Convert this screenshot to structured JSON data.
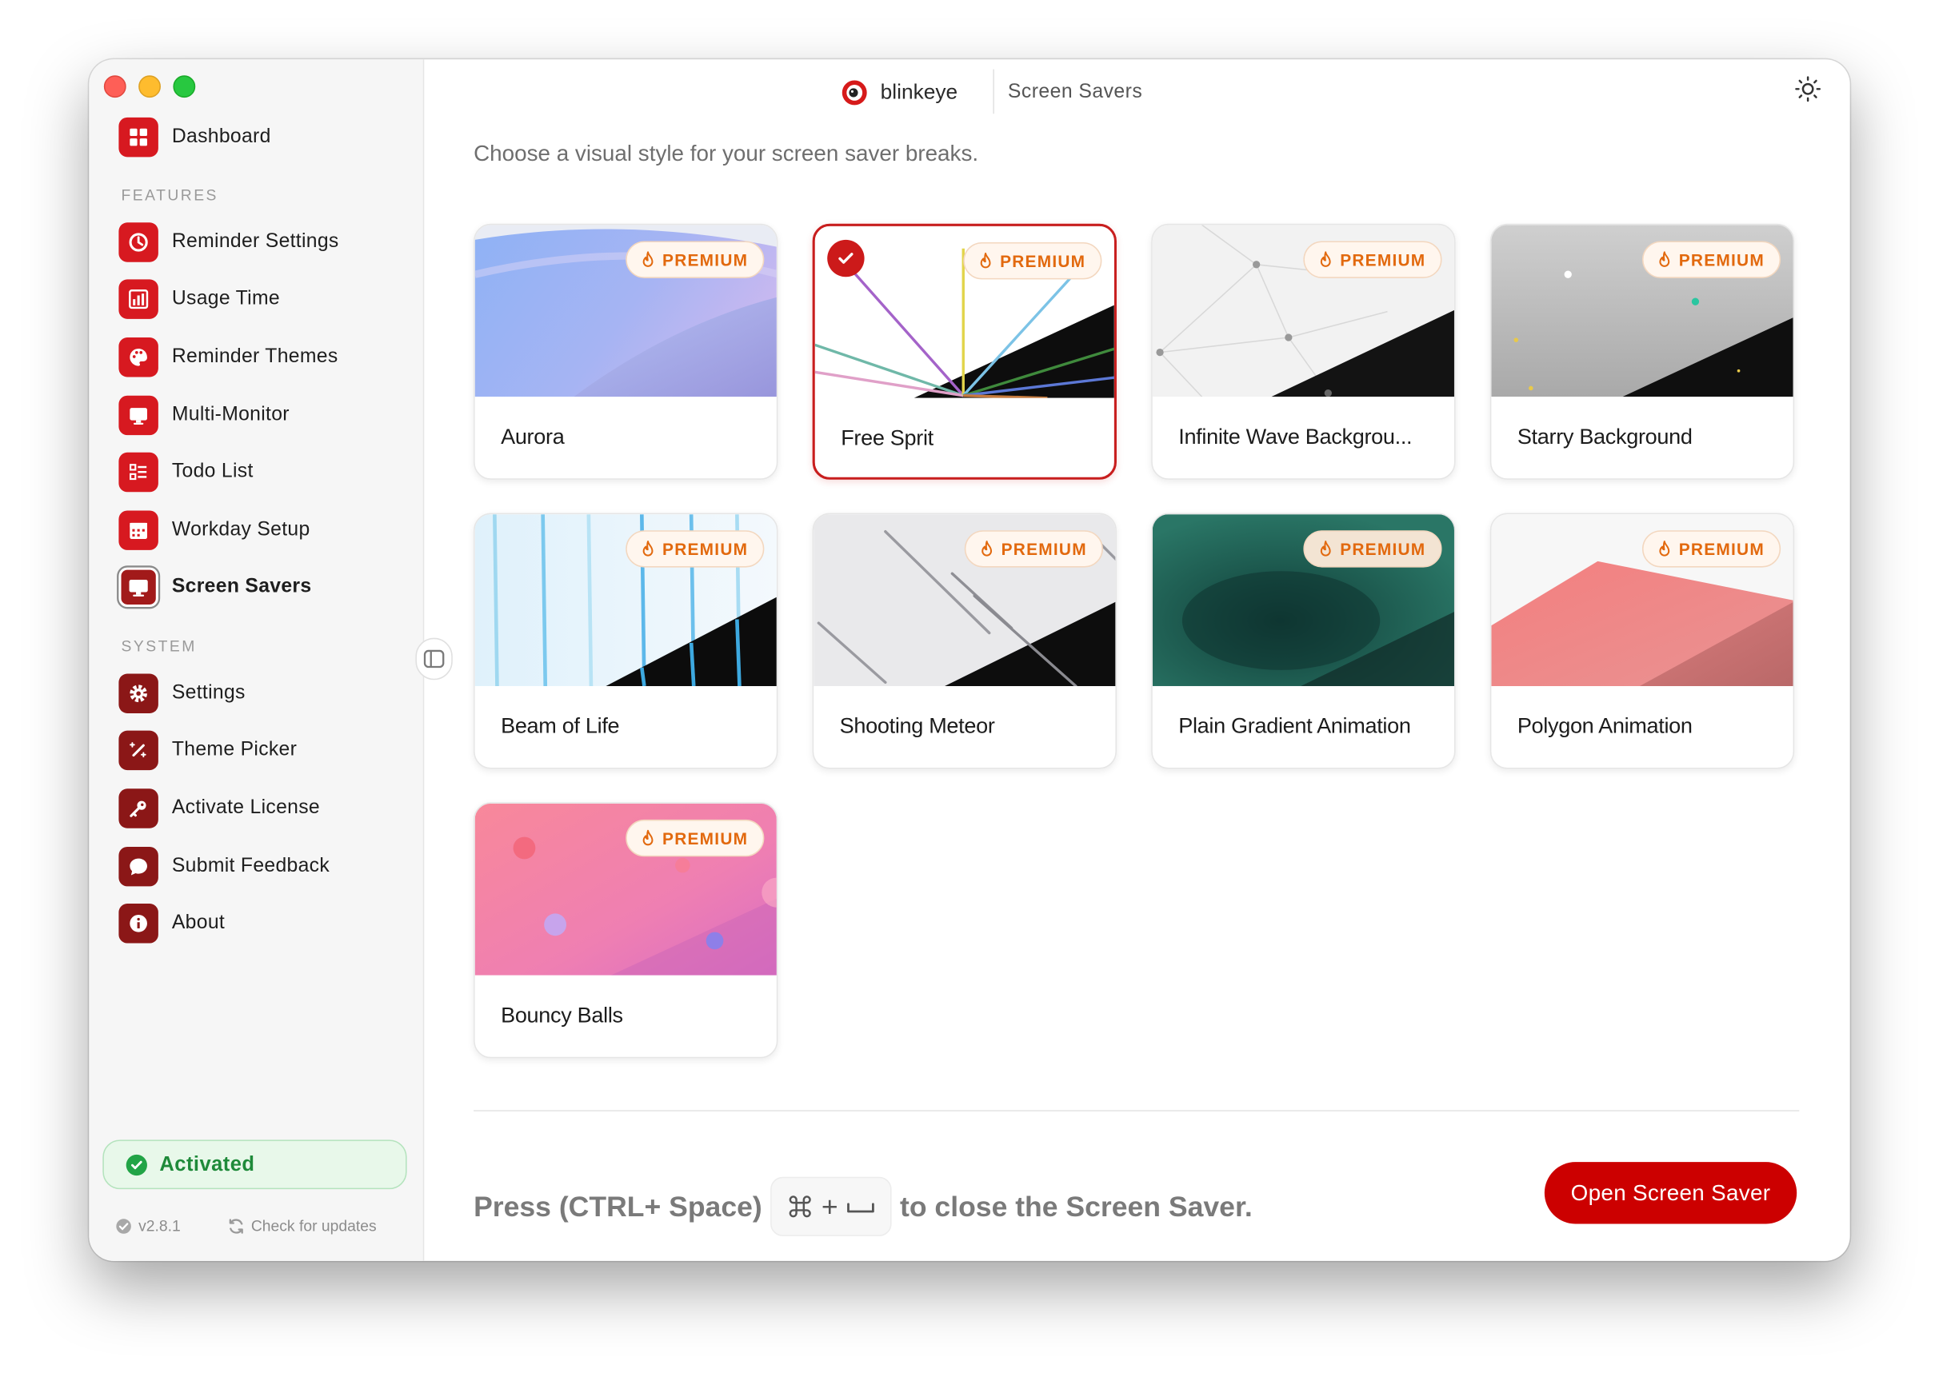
{
  "app": {
    "name": "blinkeye",
    "page": "Screen Savers"
  },
  "sidebar": {
    "top_item": {
      "label": "Dashboard",
      "icon": "grid-icon"
    },
    "features_heading": "FEATURES",
    "features": [
      {
        "label": "Reminder Settings",
        "icon": "clock-icon"
      },
      {
        "label": "Usage Time",
        "icon": "bar-chart-icon"
      },
      {
        "label": "Reminder Themes",
        "icon": "palette-icon"
      },
      {
        "label": "Multi-Monitor",
        "icon": "monitor-icon"
      },
      {
        "label": "Todo List",
        "icon": "checklist-icon"
      },
      {
        "label": "Workday Setup",
        "icon": "calendar-icon"
      },
      {
        "label": "Screen Savers",
        "icon": "screen-icon",
        "active": true
      }
    ],
    "system_heading": "SYSTEM",
    "system": [
      {
        "label": "Settings",
        "icon": "gear-icon"
      },
      {
        "label": "Theme Picker",
        "icon": "magic-wand-icon"
      },
      {
        "label": "Activate License",
        "icon": "key-icon"
      },
      {
        "label": "Submit Feedback",
        "icon": "chat-bubble-icon"
      },
      {
        "label": "About",
        "icon": "info-icon"
      }
    ],
    "status": "Activated",
    "version": "v2.8.1",
    "update_link": "Check for updates"
  },
  "main": {
    "subtitle": "Choose a visual style for your screen saver breaks.",
    "badge_label": "PREMIUM",
    "cards": [
      {
        "title": "Aurora",
        "premium": true
      },
      {
        "title": "Free Sprit",
        "premium": true,
        "selected": true
      },
      {
        "title": "Infinite Wave Backgrou...",
        "premium": true
      },
      {
        "title": "Starry Background",
        "premium": true
      },
      {
        "title": "Beam of Life",
        "premium": true
      },
      {
        "title": "Shooting Meteor",
        "premium": true
      },
      {
        "title": "Plain Gradient Animation",
        "premium": true
      },
      {
        "title": "Polygon Animation",
        "premium": true
      },
      {
        "title": "Bouncy Balls",
        "premium": true
      }
    ],
    "hint_before": "Press (CTRL+ Space)",
    "hint_key_plus": "+",
    "hint_after": "to close the Screen Saver.",
    "open_button": "Open Screen Saver"
  },
  "colors": {
    "accent": "#cc0000",
    "premium": "#e2690e",
    "activated": "#22a447"
  }
}
